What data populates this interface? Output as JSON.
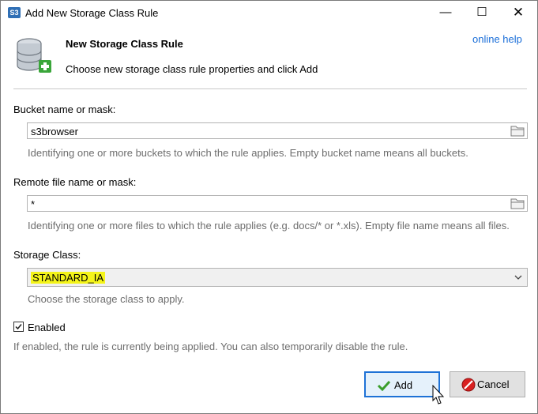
{
  "window": {
    "title": "Add New Storage Class Rule",
    "app_icon_text": "S3",
    "minimize_glyph": "—",
    "maximize_glyph": "☐",
    "close_glyph": "✕"
  },
  "header": {
    "title": "New Storage Class Rule",
    "subtitle": "Choose new storage class rule properties and click Add",
    "help_link": "online help",
    "icon": "database-add-icon"
  },
  "bucket": {
    "label": "Bucket name or mask:",
    "value": "s3browser",
    "hint": "Identifying one or more buckets to which the rule applies. Empty bucket name means all buckets."
  },
  "remote_file": {
    "label": "Remote file name or mask:",
    "value": "*",
    "hint": "Identifying one or more files to which the rule applies (e.g. docs/* or *.xls). Empty file name means all files."
  },
  "storage_class": {
    "label": "Storage Class:",
    "selected": "STANDARD_IA",
    "hint": "Choose the storage class to apply."
  },
  "enabled": {
    "label": "Enabled",
    "checked": true,
    "hint": "If enabled, the rule is currently being applied. You can also temporarily disable the rule."
  },
  "buttons": {
    "add": "Add",
    "cancel": "Cancel"
  },
  "colors": {
    "link": "#1a6ed8",
    "highlight": "#f4f41a",
    "default_button_border": "#1e72d6"
  }
}
